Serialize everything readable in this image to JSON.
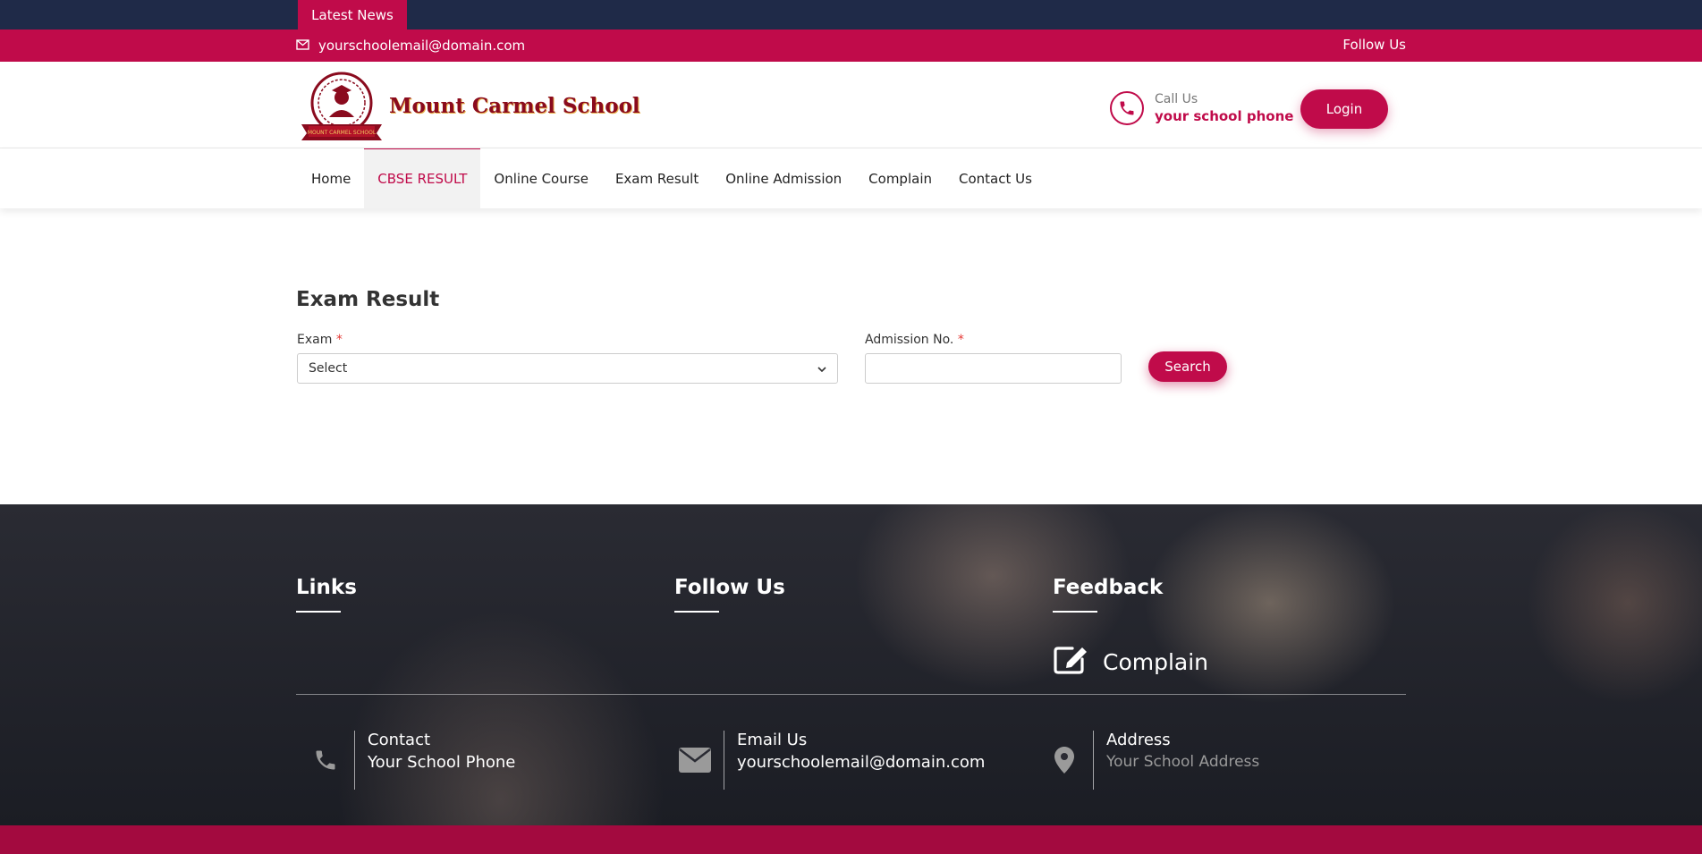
{
  "topbar": {
    "latest_news": "Latest News"
  },
  "contact_strip": {
    "email": "yourschoolemail@domain.com",
    "follow_us": "Follow Us"
  },
  "header": {
    "school_name": "Mount Carmel School",
    "badge_text": "MOUNT CARMEL SCHOOL",
    "call_label": "Call Us",
    "call_value": "your school phone",
    "login_label": "Login"
  },
  "nav": {
    "items": [
      {
        "label": "Home"
      },
      {
        "label": "CBSE RESULT",
        "active": true
      },
      {
        "label": "Online Course"
      },
      {
        "label": "Exam Result"
      },
      {
        "label": "Online Admission"
      },
      {
        "label": "Complain"
      },
      {
        "label": "Contact Us"
      }
    ]
  },
  "form": {
    "title": "Exam Result",
    "exam_label": "Exam",
    "admission_label": "Admission No.",
    "required_mark": "*",
    "exam_selected": "Select",
    "admission_value": "",
    "search_label": "Search"
  },
  "footer": {
    "links_title": "Links",
    "follow_title": "Follow Us",
    "feedback_title": "Feedback",
    "complain_label": "Complain",
    "contact_title": "Contact",
    "contact_value": "Your School Phone",
    "email_title": "Email Us",
    "email_value": "yourschoolemail@domain.com",
    "address_title": "Address",
    "address_value": "Your School Address"
  },
  "colors": {
    "accent": "#c00b4a",
    "navy": "#1f2a48",
    "footer_dark": "#1b1d24"
  }
}
